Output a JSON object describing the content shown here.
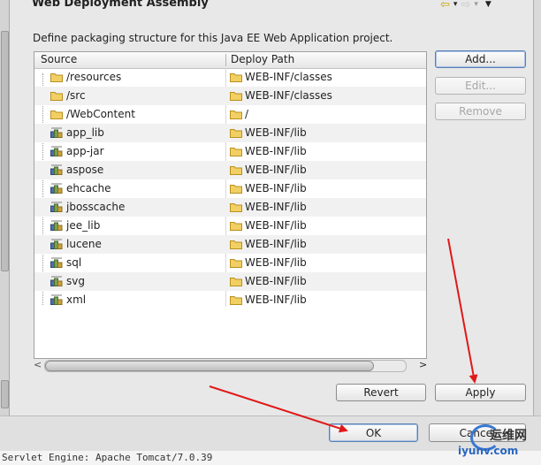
{
  "window": {
    "title": "Web Deployment Assembly"
  },
  "description": "Define packaging structure for this Java EE Web Application project.",
  "table": {
    "headers": {
      "source": "Source",
      "deploy_path": "Deploy Path"
    },
    "rows": [
      {
        "source": "/resources",
        "source_icon": "folder-icon",
        "deploy": "WEB-INF/classes"
      },
      {
        "source": "/src",
        "source_icon": "folder-icon",
        "deploy": "WEB-INF/classes"
      },
      {
        "source": "/WebContent",
        "source_icon": "folder-icon",
        "deploy": "/"
      },
      {
        "source": "app_lib",
        "source_icon": "library-icon",
        "deploy": "WEB-INF/lib"
      },
      {
        "source": "app-jar",
        "source_icon": "library-icon",
        "deploy": "WEB-INF/lib"
      },
      {
        "source": "aspose",
        "source_icon": "library-icon",
        "deploy": "WEB-INF/lib"
      },
      {
        "source": "ehcache",
        "source_icon": "library-icon",
        "deploy": "WEB-INF/lib"
      },
      {
        "source": "jbosscache",
        "source_icon": "library-icon",
        "deploy": "WEB-INF/lib"
      },
      {
        "source": "jee_lib",
        "source_icon": "library-icon",
        "deploy": "WEB-INF/lib"
      },
      {
        "source": "lucene",
        "source_icon": "library-icon",
        "deploy": "WEB-INF/lib"
      },
      {
        "source": "sql",
        "source_icon": "library-icon",
        "deploy": "WEB-INF/lib"
      },
      {
        "source": "svg",
        "source_icon": "library-icon",
        "deploy": "WEB-INF/lib"
      },
      {
        "source": "xml",
        "source_icon": "library-icon",
        "deploy": "WEB-INF/lib"
      }
    ]
  },
  "buttons": {
    "add": "Add...",
    "edit": "Edit...",
    "remove": "Remove",
    "revert": "Revert",
    "apply": "Apply",
    "ok": "OK",
    "cancel": "Cancel"
  },
  "status_text": "Servlet Engine: Apache Tomcat/7.0.39",
  "watermark": {
    "line1": "运维网",
    "line2": "iyunv.com"
  },
  "colors": {
    "arrow": "#e01818",
    "default_button_border": "#5a7fb5"
  }
}
